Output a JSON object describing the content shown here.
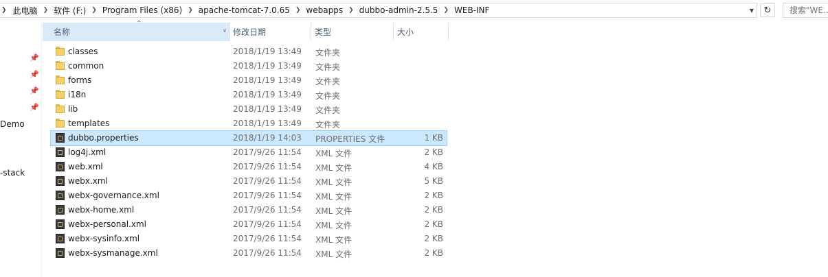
{
  "address_bar": {
    "breadcrumbs": [
      "此电脑",
      "软件 (F:)",
      "Program Files (x86)",
      "apache-tomcat-7.0.65",
      "webapps",
      "dubbo-admin-2.5.5",
      "WEB-INF"
    ]
  },
  "search": {
    "placeholder": "搜索\"WE..."
  },
  "nav_pane": {
    "items": [
      "Demo",
      "-stack"
    ]
  },
  "columns": {
    "name": "名称",
    "date": "修改日期",
    "type": "类型",
    "size": "大小"
  },
  "files": [
    {
      "name": "classes",
      "date": "2018/1/19 13:49",
      "type": "文件夹",
      "size": "",
      "kind": "folder"
    },
    {
      "name": "common",
      "date": "2018/1/19 13:49",
      "type": "文件夹",
      "size": "",
      "kind": "folder"
    },
    {
      "name": "forms",
      "date": "2018/1/19 13:49",
      "type": "文件夹",
      "size": "",
      "kind": "folder"
    },
    {
      "name": "i18n",
      "date": "2018/1/19 13:49",
      "type": "文件夹",
      "size": "",
      "kind": "folder"
    },
    {
      "name": "lib",
      "date": "2018/1/19 13:49",
      "type": "文件夹",
      "size": "",
      "kind": "folder"
    },
    {
      "name": "templates",
      "date": "2018/1/19 13:49",
      "type": "文件夹",
      "size": "",
      "kind": "folder"
    },
    {
      "name": "dubbo.properties",
      "date": "2018/1/19 14:03",
      "type": "PROPERTIES 文件",
      "size": "1 KB",
      "kind": "file",
      "selected": true
    },
    {
      "name": "log4j.xml",
      "date": "2017/9/26 11:54",
      "type": "XML 文件",
      "size": "2 KB",
      "kind": "file"
    },
    {
      "name": "web.xml",
      "date": "2017/9/26 11:54",
      "type": "XML 文件",
      "size": "4 KB",
      "kind": "file"
    },
    {
      "name": "webx.xml",
      "date": "2017/9/26 11:54",
      "type": "XML 文件",
      "size": "5 KB",
      "kind": "file"
    },
    {
      "name": "webx-governance.xml",
      "date": "2017/9/26 11:54",
      "type": "XML 文件",
      "size": "2 KB",
      "kind": "file"
    },
    {
      "name": "webx-home.xml",
      "date": "2017/9/26 11:54",
      "type": "XML 文件",
      "size": "2 KB",
      "kind": "file"
    },
    {
      "name": "webx-personal.xml",
      "date": "2017/9/26 11:54",
      "type": "XML 文件",
      "size": "2 KB",
      "kind": "file"
    },
    {
      "name": "webx-sysinfo.xml",
      "date": "2017/9/26 11:54",
      "type": "XML 文件",
      "size": "2 KB",
      "kind": "file"
    },
    {
      "name": "webx-sysmanage.xml",
      "date": "2017/9/26 11:54",
      "type": "XML 文件",
      "size": "2 KB",
      "kind": "file"
    }
  ],
  "colors": {
    "header_selected_bg": "#d9ebf9",
    "row_selected_bg": "#cce8ff",
    "row_selected_border": "#99d1ff"
  }
}
